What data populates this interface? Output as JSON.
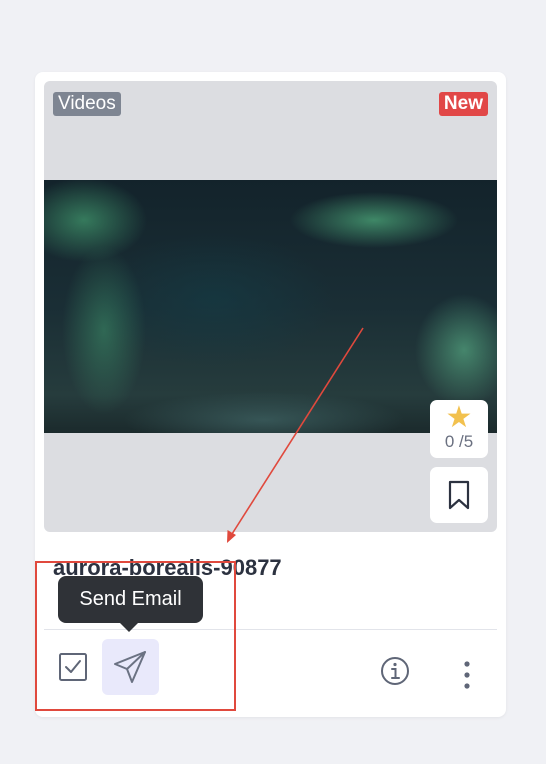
{
  "card": {
    "category_badge": "Videos",
    "new_badge": "New",
    "rating_text": "0 /5",
    "title": "aurora-borealis-90877"
  },
  "tooltip": {
    "label": "Send Email"
  },
  "icons": {
    "rating": "star-icon",
    "bookmark": "bookmark-icon",
    "select": "checkbox-icon",
    "send": "paper-plane-icon",
    "info": "info-icon",
    "more": "more-vertical-icon"
  },
  "colors": {
    "new_badge": "#e14747",
    "category_badge": "#7e8592",
    "star": "#f2c14e",
    "send_button_bg": "#e9e9fb",
    "tooltip_bg": "#2f3237",
    "annotation": "#e0493d"
  }
}
